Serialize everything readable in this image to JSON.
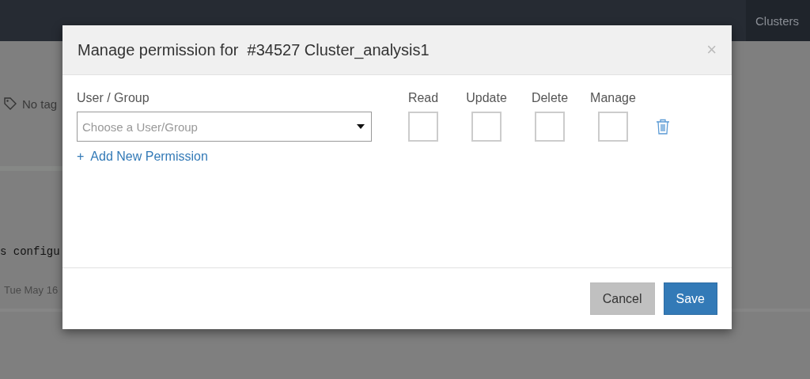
{
  "background": {
    "nav_item": "Clusters",
    "tags": "No tag",
    "config_text": "s configu",
    "date_text": "Tue May 16"
  },
  "dialog": {
    "title": "Manage permission for  #34527 Cluster_analysis1",
    "close": "×",
    "user_label": "User / Group",
    "columns": [
      "Read",
      "Update",
      "Delete",
      "Manage"
    ],
    "rows": [
      {
        "user_placeholder": "Choose a User/Group",
        "permissions": [
          {
            "checked": false
          },
          {
            "checked": false
          },
          {
            "checked": false
          },
          {
            "checked": false
          }
        ]
      }
    ],
    "add_plus": "+",
    "add_link": "Add New Permission",
    "buttons": [
      {
        "label": "Cancel",
        "kind": "secondary"
      },
      {
        "label": "Save",
        "kind": "primary"
      }
    ]
  }
}
